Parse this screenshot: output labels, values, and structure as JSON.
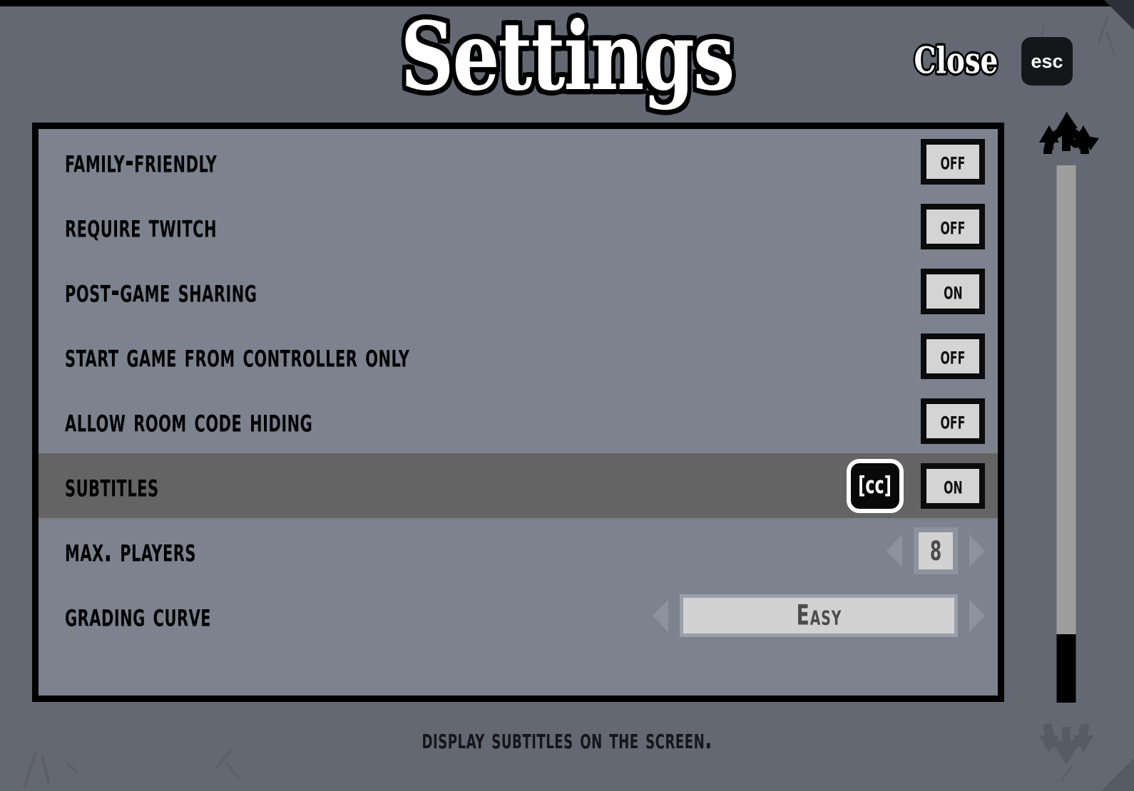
{
  "window": {
    "title": "Settings",
    "close_label": "Close",
    "esc_key_label": "esc"
  },
  "colors": {
    "background": "#646873",
    "panel": "#7c838f",
    "panel_border": "#000000",
    "row_selected": "#646464",
    "button_face": "#d4d4d4",
    "button_border": "#0b0b0b",
    "scrollbar_track": "#9e9e9e",
    "scrollbar_thumb": "#000000",
    "dim_arrow": "#8d939e"
  },
  "settings": {
    "rows": [
      {
        "label": "Family-Friendly",
        "control": "toggle",
        "value": "Off",
        "selected": false,
        "icon": null
      },
      {
        "label": "Require Twitch",
        "control": "toggle",
        "value": "Off",
        "selected": false,
        "icon": null
      },
      {
        "label": "Post-Game Sharing",
        "control": "toggle",
        "value": "On",
        "selected": false,
        "icon": null
      },
      {
        "label": "Start Game from Controller Only",
        "control": "toggle",
        "value": "Off",
        "selected": false,
        "icon": null
      },
      {
        "label": "Allow Room Code Hiding",
        "control": "toggle",
        "value": "Off",
        "selected": false,
        "icon": null
      },
      {
        "label": "Subtitles",
        "control": "toggle",
        "value": "On",
        "selected": true,
        "icon": "cc-icon",
        "icon_label": "[cc]"
      },
      {
        "label": "Max. Players",
        "control": "stepper",
        "value": "8",
        "selected": false,
        "icon": null
      },
      {
        "label": "Grading Curve",
        "control": "wide",
        "value": "Easy",
        "selected": false,
        "icon": null
      }
    ]
  },
  "scrollbar": {
    "up_arrow_icon": "trident-up-icon",
    "down_arrow_icon": "trident-down-icon",
    "thumb_position": "bottom"
  },
  "caption": {
    "text": "Display subtitles on the screen."
  }
}
